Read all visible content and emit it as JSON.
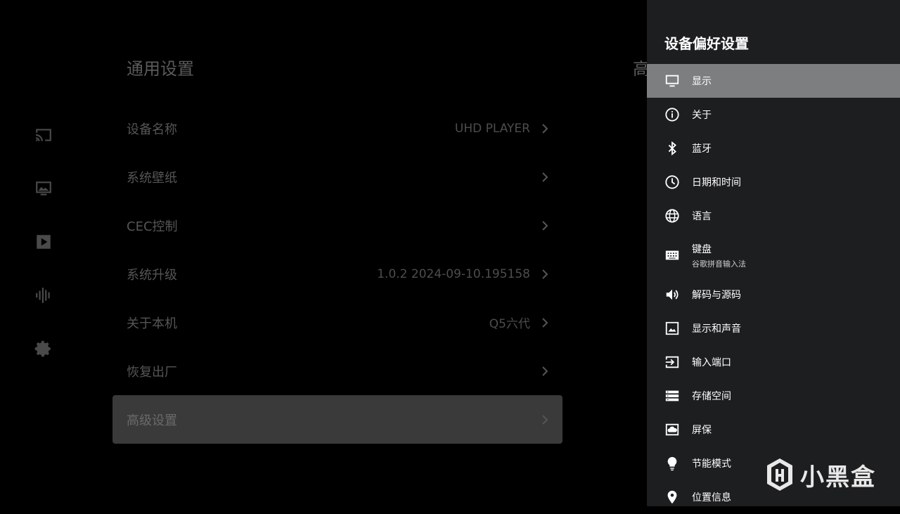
{
  "rail": {
    "icons": [
      "cast-icon",
      "wallpaper-icon",
      "play-icon",
      "audio-wave-icon",
      "settings-gear-icon"
    ]
  },
  "main": {
    "title": "通用设置",
    "peek_title": "高",
    "rows": [
      {
        "label": "设备名称",
        "value": "UHD PLAYER"
      },
      {
        "label": "系统壁纸",
        "value": ""
      },
      {
        "label": "CEC控制",
        "value": ""
      },
      {
        "label": "系统升级",
        "value": "1.0.2 2024-09-10.195158"
      },
      {
        "label": "关于本机",
        "value": "Q5六代"
      },
      {
        "label": "恢复出厂",
        "value": ""
      },
      {
        "label": "高级设置",
        "value": ""
      }
    ]
  },
  "drawer": {
    "title": "设备偏好设置",
    "items": [
      {
        "label": "显示",
        "icon": "monitor-icon"
      },
      {
        "label": "关于",
        "icon": "info-icon"
      },
      {
        "label": "蓝牙",
        "icon": "bluetooth-icon"
      },
      {
        "label": "日期和时间",
        "icon": "clock-icon"
      },
      {
        "label": "语言",
        "icon": "globe-icon"
      },
      {
        "label": "键盘",
        "sub": "谷歌拼音输入法",
        "icon": "keyboard-icon"
      },
      {
        "label": "解码与源码",
        "icon": "volume-icon"
      },
      {
        "label": "显示和声音",
        "icon": "image-icon"
      },
      {
        "label": "输入端口",
        "icon": "input-icon"
      },
      {
        "label": "存储空间",
        "icon": "storage-icon"
      },
      {
        "label": "屏保",
        "icon": "screensaver-icon"
      },
      {
        "label": "节能模式",
        "icon": "lightbulb-icon"
      },
      {
        "label": "位置信息",
        "icon": "location-icon"
      }
    ]
  },
  "watermark": {
    "text": "小黑盒"
  }
}
